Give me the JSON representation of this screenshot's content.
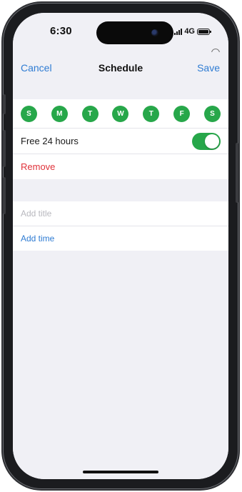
{
  "status_bar": {
    "time": "6:30",
    "network": "4G"
  },
  "navbar": {
    "cancel_label": "Cancel",
    "title": "Schedule",
    "save_label": "Save"
  },
  "days": [
    {
      "label": "S",
      "selected": true
    },
    {
      "label": "M",
      "selected": true
    },
    {
      "label": "T",
      "selected": true
    },
    {
      "label": "W",
      "selected": true
    },
    {
      "label": "T",
      "selected": true
    },
    {
      "label": "F",
      "selected": true
    },
    {
      "label": "S",
      "selected": true
    }
  ],
  "free24": {
    "label": "Free 24 hours",
    "enabled": true
  },
  "remove_label": "Remove",
  "title_field": {
    "placeholder": "Add title",
    "value": ""
  },
  "add_time_label": "Add time",
  "colors": {
    "accent_blue": "#2f7cd3",
    "day_green": "#27a74a",
    "destructive_red": "#e0323a"
  }
}
